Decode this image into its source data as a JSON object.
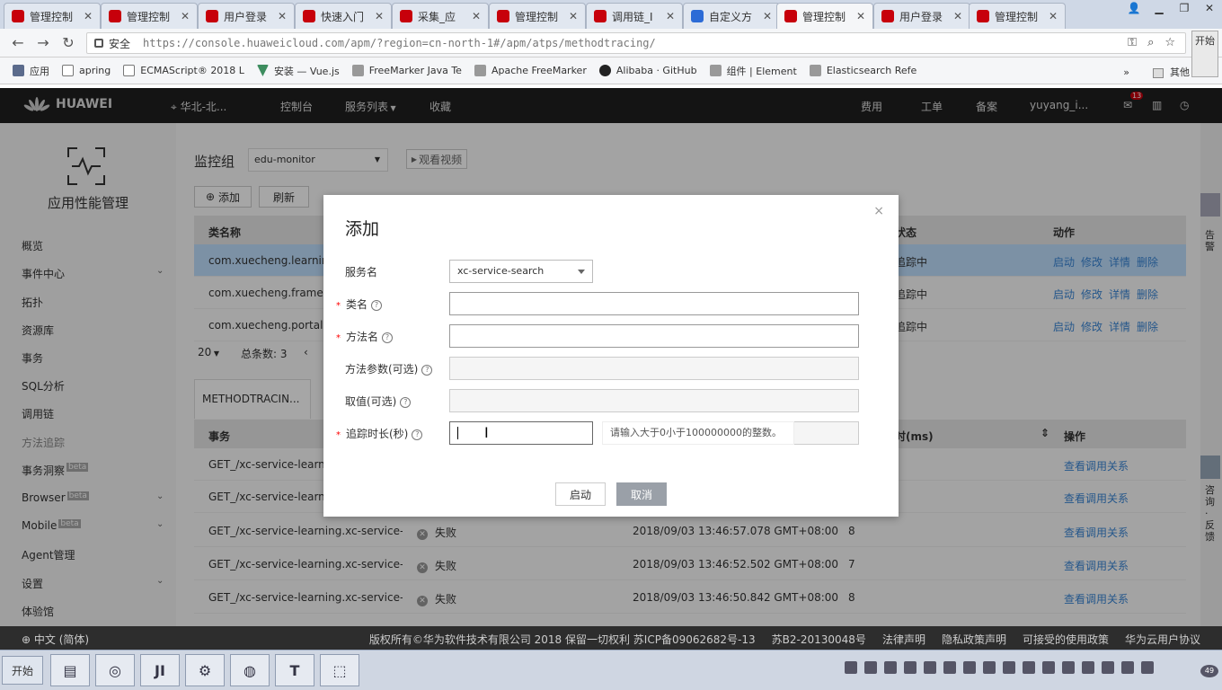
{
  "browser": {
    "tabs": [
      {
        "label": "管理控制"
      },
      {
        "label": "管理控制"
      },
      {
        "label": "用户登录"
      },
      {
        "label": "快速入门"
      },
      {
        "label": "采集_应"
      },
      {
        "label": "管理控制"
      },
      {
        "label": "调用链_I"
      },
      {
        "label": "自定义方"
      },
      {
        "label": "管理控制"
      },
      {
        "label": "用户登录"
      },
      {
        "label": "管理控制"
      }
    ],
    "secure_label": "安全",
    "url": "https://console.huaweicloud.com/apm/?region=cn-north-1#/apm/atps/methodtracing/",
    "ext_label": "开始",
    "bookmarks": [
      {
        "label": "应用",
        "icon": "grid-icon"
      },
      {
        "label": "apring",
        "icon": "file-icon"
      },
      {
        "label": "ECMAScript® 2018 L",
        "icon": "file-icon"
      },
      {
        "label": "安装 — Vue.js",
        "icon": "vue-icon"
      },
      {
        "label": "FreeMarker Java Te",
        "icon": "code-icon"
      },
      {
        "label": "Apache FreeMarker",
        "icon": "code-icon"
      },
      {
        "label": "Alibaba · GitHub",
        "icon": "github-icon"
      },
      {
        "label": "组件 | Element",
        "icon": "element-icon"
      },
      {
        "label": "Elasticsearch Refe",
        "icon": "es-icon"
      }
    ],
    "bookmarks_more": "»",
    "bookmarks_other": "其他"
  },
  "topnav": {
    "brand": "HUAWEI",
    "region": "华北-北...",
    "console": "控制台",
    "services": "服务列表",
    "favorites": "收藏",
    "fees": "费用",
    "tickets": "工单",
    "filing": "备案",
    "user": "yuyang_i...",
    "msg_count": "13"
  },
  "sidebar": {
    "title": "应用性能管理",
    "items": [
      {
        "label": "概览"
      },
      {
        "label": "事件中心"
      },
      {
        "label": "拓扑"
      },
      {
        "label": "资源库"
      },
      {
        "label": "事务"
      },
      {
        "label": "SQL分析"
      },
      {
        "label": "调用链"
      },
      {
        "label": "方法追踪"
      },
      {
        "label": "事务洞察",
        "beta": "beta"
      },
      {
        "label": "Browser",
        "beta": "beta"
      },
      {
        "label": "Mobile",
        "beta": "beta"
      },
      {
        "label": "Agent管理"
      },
      {
        "label": "设置"
      },
      {
        "label": "体验馆"
      }
    ]
  },
  "main": {
    "monitor_group_label": "监控组",
    "monitor_group_value": "edu-monitor",
    "watch_video": "观看视频",
    "add_btn": "添加",
    "refresh_btn": "刷新",
    "table1": {
      "headers": {
        "class": "类名称",
        "status": "状态",
        "action": "动作"
      },
      "rows": [
        {
          "class": "com.xuecheng.learning",
          "status": "追踪中",
          "actions": [
            "启动",
            "修改",
            "详情",
            "删除"
          ]
        },
        {
          "class": "com.xuecheng.framewo",
          "status": "追踪中",
          "actions": [
            "启动",
            "修改",
            "详情",
            "删除"
          ]
        },
        {
          "class": "com.xuecheng.portalvie",
          "status": "追踪中",
          "actions": [
            "启动",
            "修改",
            "详情",
            "删除"
          ]
        }
      ],
      "page_size": "20",
      "total": "总条数: 3"
    },
    "method_tab": "METHODTRACIN...",
    "table2": {
      "headers": {
        "tx": "事务",
        "ms": "时(ms)",
        "op": "操作"
      },
      "rows": [
        {
          "tx": "GET_/xc-service-learning.xc-service-l...",
          "status": "",
          "time": "",
          "ms": "",
          "op": "查看调用关系"
        },
        {
          "tx": "GET_/xc-service-learning.xc-service-l...",
          "status": "",
          "time": "",
          "ms": "",
          "op": "查看调用关系"
        },
        {
          "tx": "GET_/xc-service-learning.xc-service-l...",
          "status": "失败",
          "time": "2018/09/03 13:46:57.078 GMT+08:00",
          "ms": "8",
          "op": "查看调用关系"
        },
        {
          "tx": "GET_/xc-service-learning.xc-service-l...",
          "status": "失败",
          "time": "2018/09/03 13:46:52.502 GMT+08:00",
          "ms": "7",
          "op": "查看调用关系"
        },
        {
          "tx": "GET_/xc-service-learning.xc-service-l...",
          "status": "失败",
          "time": "2018/09/03 13:46:50.842 GMT+08:00",
          "ms": "8",
          "op": "查看调用关系"
        }
      ]
    }
  },
  "rail": {
    "alert": "告警",
    "feedback": "咨询·反馈"
  },
  "footer": {
    "lang": "中文 (简体)",
    "links": [
      "版权所有©华为软件技术有限公司 2018 保留一切权利 苏ICP备09062682号-13",
      "苏B2-20130048号",
      "法律声明",
      "隐私政策声明",
      "可接受的使用政策",
      "华为云用户协议"
    ]
  },
  "modal": {
    "title": "添加",
    "service_label": "服务名",
    "service_value": "xc-service-search",
    "class_label": "类名",
    "method_label": "方法名",
    "params_label": "方法参数(可选)",
    "value_label": "取值(可选)",
    "duration_label": "追踪时长(秒)",
    "duration_tip": "请输入大于0小于100000000的整数。",
    "start_btn": "启动",
    "cancel_btn": "取消"
  },
  "taskbar": {
    "start": "开始",
    "clock_badge": "49"
  }
}
